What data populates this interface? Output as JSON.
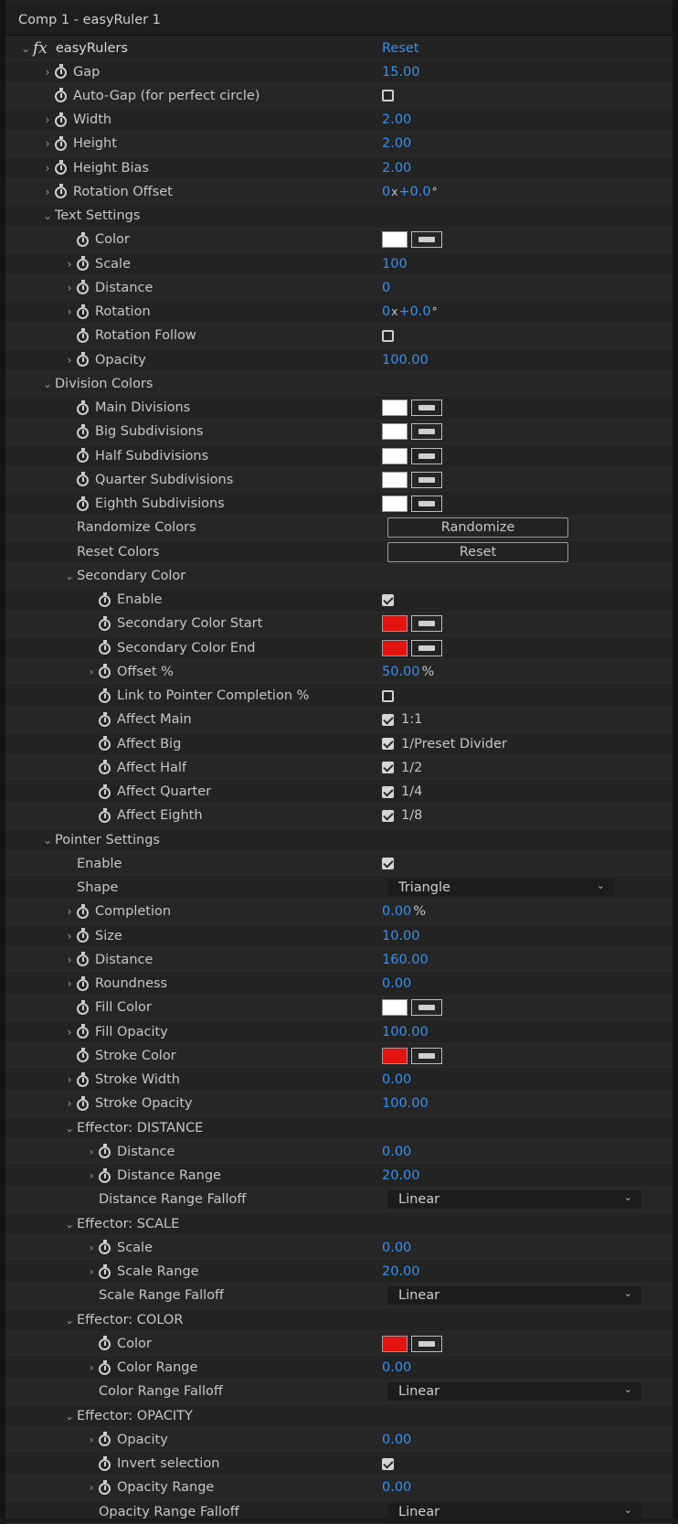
{
  "window_title": "Comp 1 - easyRuler 1",
  "effect": {
    "name": "easyRulers",
    "reset_label": "Reset"
  },
  "rows": [
    {
      "label": "Gap",
      "value": "15.00"
    },
    {
      "label": "Auto-Gap (for perfect circle)",
      "checkbox": false
    },
    {
      "label": "Width",
      "value": "2.00"
    },
    {
      "label": "Height",
      "value": "2.00"
    },
    {
      "label": "Height Bias",
      "value": "2.00"
    },
    {
      "label": "Rotation Offset",
      "rot_a": "0",
      "rot_x": "x",
      "rot_b": "+0.0",
      "rot_deg": "°"
    },
    {
      "label": "Text Settings"
    },
    {
      "label": "Color",
      "color": "#ffffff"
    },
    {
      "label": "Scale",
      "value": "100"
    },
    {
      "label": "Distance",
      "value": "0"
    },
    {
      "label": "Rotation",
      "rot_a": "0",
      "rot_x": "x",
      "rot_b": "+0.0",
      "rot_deg": "°"
    },
    {
      "label": "Rotation Follow",
      "checkbox": false
    },
    {
      "label": "Opacity",
      "value": "100.00"
    },
    {
      "label": "Division Colors"
    },
    {
      "label": "Main Divisions",
      "color": "#ffffff"
    },
    {
      "label": "Big Subdivisions",
      "color": "#ffffff"
    },
    {
      "label": "Half Subdivisions",
      "color": "#ffffff"
    },
    {
      "label": "Quarter Subdivisions",
      "color": "#ffffff"
    },
    {
      "label": "Eighth Subdivisions",
      "color": "#ffffff"
    },
    {
      "label": "Randomize Colors",
      "button": "Randomize"
    },
    {
      "label": "Reset Colors",
      "button": "Reset"
    },
    {
      "label": "Secondary Color"
    },
    {
      "label": "Enable",
      "checkbox": true
    },
    {
      "label": "Secondary Color Start",
      "color": "#e3130f"
    },
    {
      "label": "Secondary Color End",
      "color": "#e3130f"
    },
    {
      "label": "Offset %",
      "value": "50.00",
      "unit": "%"
    },
    {
      "label": "Link to Pointer Completion %",
      "checkbox": false
    },
    {
      "label": "Affect Main",
      "checkbox": true,
      "check_label": "1:1"
    },
    {
      "label": "Affect Big",
      "checkbox": true,
      "check_label": "1/Preset Divider"
    },
    {
      "label": "Affect Half",
      "checkbox": true,
      "check_label": "1/2"
    },
    {
      "label": "Affect Quarter",
      "checkbox": true,
      "check_label": "1/4"
    },
    {
      "label": "Affect Eighth",
      "checkbox": true,
      "check_label": "1/8"
    },
    {
      "label": "Pointer Settings"
    },
    {
      "label": "Enable",
      "checkbox": true
    },
    {
      "label": "Shape",
      "select": "Triangle"
    },
    {
      "label": "Completion",
      "value": "0.00",
      "unit": "%"
    },
    {
      "label": "Size",
      "value": "10.00"
    },
    {
      "label": "Distance",
      "value": "160.00"
    },
    {
      "label": "Roundness",
      "value": "0.00"
    },
    {
      "label": "Fill Color",
      "color": "#ffffff"
    },
    {
      "label": "Fill Opacity",
      "value": "100.00"
    },
    {
      "label": "Stroke Color",
      "color": "#e3130f"
    },
    {
      "label": "Stroke Width",
      "value": "0.00"
    },
    {
      "label": "Stroke Opacity",
      "value": "100.00"
    },
    {
      "label": "Effector: DISTANCE"
    },
    {
      "label": "Distance",
      "value": "0.00"
    },
    {
      "label": "Distance Range",
      "value": "20.00"
    },
    {
      "label": "Distance Range Falloff",
      "select": "Linear"
    },
    {
      "label": "Effector: SCALE"
    },
    {
      "label": "Scale",
      "value": "0.00"
    },
    {
      "label": "Scale Range",
      "value": "20.00"
    },
    {
      "label": "Scale Range Falloff",
      "select": "Linear"
    },
    {
      "label": "Effector: COLOR"
    },
    {
      "label": "Color",
      "color": "#e3130f"
    },
    {
      "label": "Color Range",
      "value": "0.00"
    },
    {
      "label": "Color Range Falloff",
      "select": "Linear"
    },
    {
      "label": "Effector: OPACITY"
    },
    {
      "label": "Opacity",
      "value": "0.00"
    },
    {
      "label": "Invert selection",
      "checkbox": true
    },
    {
      "label": "Opacity Range",
      "value": "0.00"
    },
    {
      "label": "Opacity Range Falloff",
      "select": "Linear"
    }
  ]
}
